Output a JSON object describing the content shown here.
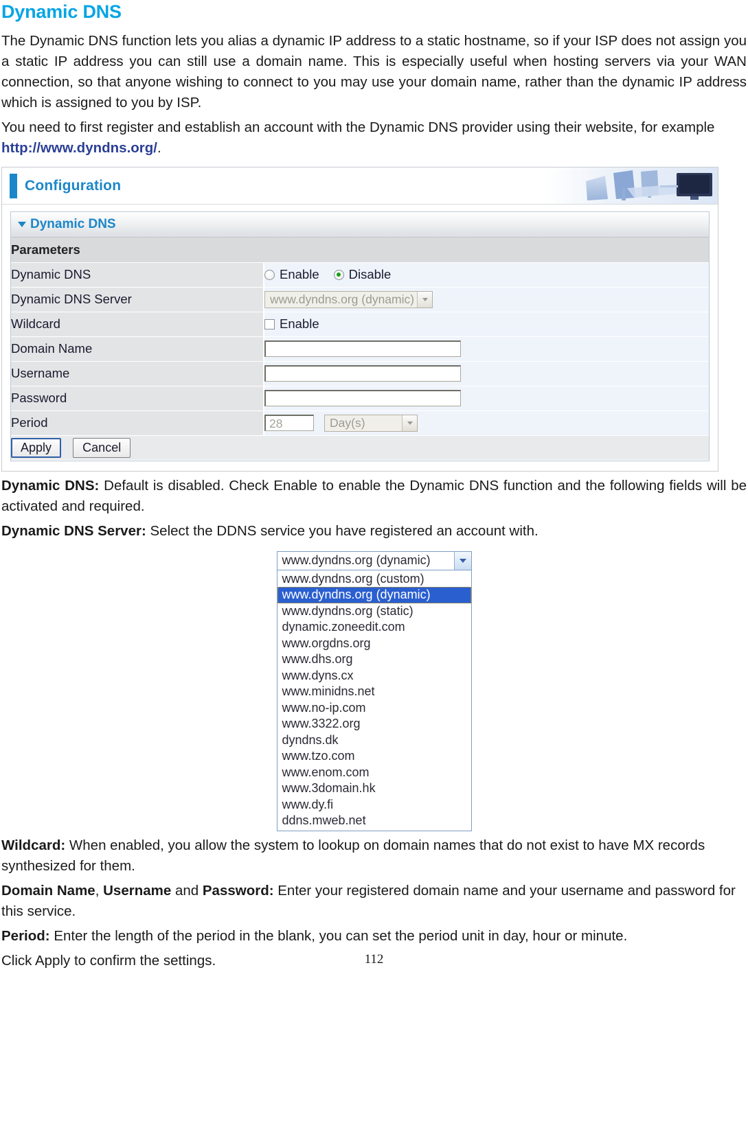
{
  "page": {
    "title": "Dynamic DNS",
    "page_number": "112"
  },
  "intro": {
    "paragraph1": "The Dynamic DNS function lets you alias a dynamic IP address to a static hostname, so if your ISP does not assign you a static IP address you can still use a domain name. This is especially useful when hosting servers via your WAN connection, so that anyone wishing to connect to you may use your domain name, rather than the dynamic IP address which is assigned to you by ISP.",
    "paragraph2_prefix": "You need to first register and establish an account with the Dynamic DNS provider using their website, for example ",
    "paragraph2_link": "http://www.dyndns.org/",
    "paragraph2_suffix": "."
  },
  "router_ui": {
    "header_title": "Configuration",
    "panel_title": "Dynamic DNS",
    "section_header": "Parameters",
    "rows": {
      "dynamic_dns": {
        "label": "Dynamic DNS",
        "option_enable": "Enable",
        "option_disable": "Disable",
        "selected": "Disable"
      },
      "dynamic_dns_server": {
        "label": "Dynamic DNS Server",
        "value": "www.dyndns.org (dynamic)"
      },
      "wildcard": {
        "label": "Wildcard",
        "checkbox_label": "Enable",
        "checked": false
      },
      "domain_name": {
        "label": "Domain Name",
        "value": ""
      },
      "username": {
        "label": "Username",
        "value": ""
      },
      "password": {
        "label": "Password",
        "value": ""
      },
      "period": {
        "label": "Period",
        "value": "28",
        "unit": "Day(s)"
      }
    },
    "buttons": {
      "apply": "Apply",
      "cancel": "Cancel"
    }
  },
  "dropdown": {
    "selected_value": "www.dyndns.org (dynamic)",
    "options": [
      "www.dyndns.org (custom)",
      "www.dyndns.org (dynamic)",
      "www.dyndns.org (static)",
      "dynamic.zoneedit.com",
      "www.orgdns.org",
      "www.dhs.org",
      "www.dyns.cx",
      "www.minidns.net",
      "www.no-ip.com",
      "www.3322.org",
      "dyndns.dk",
      "www.tzo.com",
      "www.enom.com",
      "www.3domain.hk",
      "www.dy.fi",
      "ddns.mweb.net"
    ],
    "selected_index": 1
  },
  "descriptions": {
    "dynamic_dns": {
      "term": "Dynamic DNS:",
      "text": " Default is disabled. Check Enable to enable the Dynamic DNS function and the following fields will be activated and required."
    },
    "dynamic_dns_server": {
      "term": "Dynamic DNS Server:",
      "text": " Select the DDNS service you have registered an account with."
    },
    "wildcard": {
      "term": "Wildcard:",
      "text": " When enabled, you allow the system to lookup on domain names that do not exist to have MX records synthesized for them."
    },
    "credentials": {
      "term_a": "Domain Name",
      "sep_a": ", ",
      "term_b": "Username",
      "sep_b": " and ",
      "term_c": "Password:",
      "text": " Enter your registered domain name and your username and password for this service."
    },
    "period": {
      "term": "Period:",
      "text": " Enter the length of the period in the blank, you can set the period unit in day, hour or minute."
    },
    "closing": "Click Apply to confirm the settings."
  },
  "colors": {
    "heading": "#06a5e4",
    "link": "#2b3f96",
    "ui_accent": "#1b87c9",
    "radio_on": "#18a018",
    "dropdown_highlight": "#2a5fd0"
  }
}
